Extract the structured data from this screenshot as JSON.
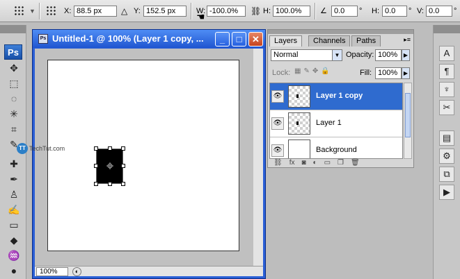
{
  "options_bar": {
    "x_label": "X:",
    "x_value": "88.5 px",
    "y_label": "Y:",
    "y_value": "152.5 px",
    "w_label": "W:",
    "w_value": "-100.0%",
    "h_label": "H:",
    "h_value": "100.0%",
    "angle_value": "0.0",
    "angle_unit": "°",
    "hskew_label": "H:",
    "hskew_value": "0.0",
    "hskew_unit": "°",
    "vskew_label": "V:",
    "vskew_value": "0.0",
    "vskew_unit": "°"
  },
  "tools": {
    "logo": "Ps"
  },
  "document": {
    "title": "Untitled-1 @ 100% (Layer 1 copy, ...",
    "zoom": "100%"
  },
  "watermark": {
    "text": "TechTut.com"
  },
  "layers_panel": {
    "tabs": [
      "Layers",
      "Channels",
      "Paths"
    ],
    "blend_mode": "Normal",
    "opacity_label": "Opacity:",
    "opacity_value": "100%",
    "lock_label": "Lock:",
    "fill_label": "Fill:",
    "fill_value": "100%",
    "layers": [
      {
        "name": "Layer 1 copy",
        "selected": true
      },
      {
        "name": "Layer 1",
        "selected": false
      },
      {
        "name": "Background",
        "selected": false
      }
    ]
  },
  "colors": {
    "accent": "#2f6bcf",
    "title_bar": "#2a5fd6"
  }
}
